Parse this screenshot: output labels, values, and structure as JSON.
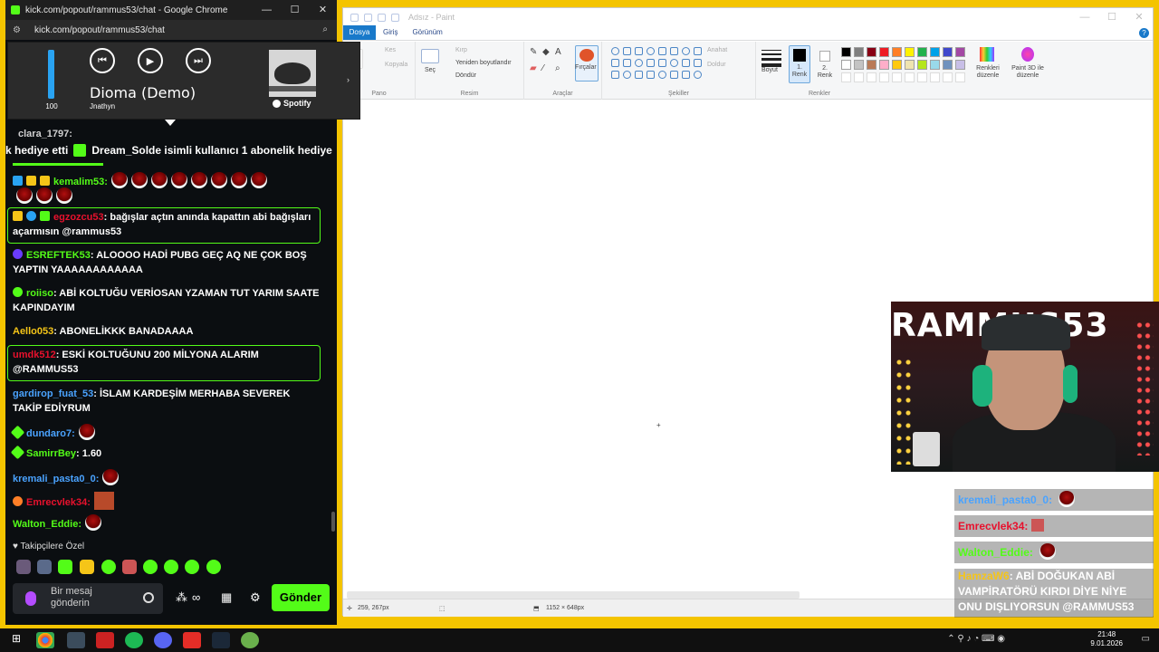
{
  "chrome": {
    "title": "kick.com/popout/rammus53/chat - Google Chrome",
    "url": "kick.com/popout/rammus53/chat"
  },
  "spotify": {
    "volume": 100,
    "volume_label": "100",
    "song": "Dioma (Demo)",
    "artist": "Jnathyn",
    "brand": "Spotify"
  },
  "chat": {
    "partial_top": "clara_1797:",
    "gift_banner": {
      "prefix": "k hediye etti",
      "user": "Dream_Solde",
      "suffix": "isimli kullanıcı 1 abonelik hediye"
    },
    "messages": [
      {
        "user": "kemalim53:",
        "text": "",
        "color": "#53fc18",
        "emotes": 8,
        "emotes2": 3
      },
      {
        "user": "egzozcu53",
        "text": ": bağışlar açtın anında kapattın abi bağışları açarmısın @rammus53",
        "color": "#e8112d"
      },
      {
        "user": "ESREFTEK53",
        "text": ": ALOOOO HADİ PUBG GEÇ AQ NE ÇOK BOŞ YAPTIN YAAAAAAAAAAAA",
        "color": "#53fc18"
      },
      {
        "user": "roiiso",
        "text": ": ABİ KOLTUĞU VERİOSAN YZAMAN TUT YARIM SAATE KAPINDAYIM",
        "color": "#53fc18"
      },
      {
        "user": "Aello053",
        "text": ": ABONELİKKK BANADAAAA",
        "color": "#f5c518"
      },
      {
        "user": "umdk512",
        "text": ": ESKİ KOLTUĞUNU 200 MİLYONA ALARIM @RAMMUS53",
        "color": "#e8112d"
      },
      {
        "user": "gardirop_fuat_53",
        "text": ": İSLAM KARDEŞİM MERHABA SEVEREK TAKİP EDİYRUM",
        "color": "#4aa3ff"
      },
      {
        "user": "dundaro7:",
        "text": "",
        "color": "#4aa3ff"
      },
      {
        "user": "SamirrBey",
        "text": ": 1.60",
        "color": "#53fc18"
      },
      {
        "user": "kremali_pasta0_0:",
        "text": "",
        "color": "#4aa3ff"
      },
      {
        "user": "Emrecvlek34:",
        "text": "",
        "color": "#e8112d"
      },
      {
        "user": "Walton_Eddie:",
        "text": "",
        "color": "#53fc18"
      }
    ],
    "followers_only": "Takipçilere Özel",
    "input_placeholder": "Bir mesaj gönderin",
    "send_label": "Gönder"
  },
  "paint": {
    "title": "Adsız - Paint",
    "tabs": [
      "Dosya",
      "Giriş",
      "Görünüm"
    ],
    "groups": {
      "clipboard": "Pano",
      "image": "Resim",
      "tools": "Araçlar",
      "shapes": "Şekiller",
      "colors": "Renkler"
    },
    "clipboard_items": [
      "Kes",
      "Kopyala"
    ],
    "select_label": "Seç",
    "image_items": [
      "Kırp",
      "Yeniden boyutlandır",
      "Döndür"
    ],
    "brushes_label": "Fırçalar",
    "shape_options": [
      "Anahat",
      "Doldur"
    ],
    "size_label": "Boyut",
    "color1_label": "1. Renk",
    "color2_label": "2. Renk",
    "edit_colors_label": "Renkleri düzenle",
    "paint3d_label": "Paint 3D ile düzenle",
    "palette": [
      "#000000",
      "#7f7f7f",
      "#880015",
      "#ed1c24",
      "#ff7f27",
      "#fff200",
      "#22b14c",
      "#00a2e8",
      "#3f48cc",
      "#a349a4",
      "#ffffff",
      "#c3c3c3",
      "#b97a57",
      "#ffaec9",
      "#ffc90e",
      "#efe4b0",
      "#b5e61d",
      "#99d9ea",
      "#7092be",
      "#c8bfe7"
    ],
    "cursor_pos": "259, 267px",
    "canvas_size": "1152 × 648px"
  },
  "overlay_chat": [
    {
      "user": "kremali_pasta0_0:",
      "color": "#4aa3ff"
    },
    {
      "user": "Emrecvlek34:",
      "color": "#e8112d"
    },
    {
      "user": "Walton_Eddie:",
      "color": "#53fc18"
    },
    {
      "user": "HamzaW6",
      "color": "#f5c518",
      "text": ": ABİ DOĞUKAN ABİ VAMPİRATÖRÜ KIRDI DİYE NİYE ONU DIŞLIYORSUN @RAMMUS53"
    }
  ],
  "webcam": {
    "banner": "RAMMUS53"
  },
  "taskbar": {
    "time": "21:48",
    "date": "9.01.2026"
  }
}
